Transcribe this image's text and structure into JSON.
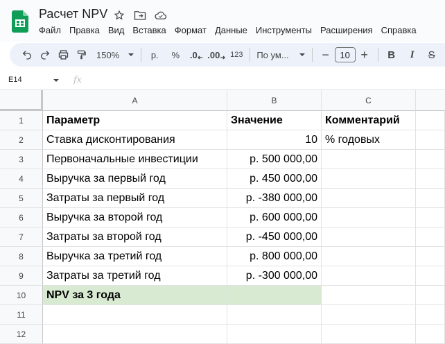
{
  "app": {
    "title": "Расчет NPV",
    "menu": [
      "Файл",
      "Правка",
      "Вид",
      "Вставка",
      "Формат",
      "Данные",
      "Инструменты",
      "Расширения",
      "Справка"
    ]
  },
  "toolbar": {
    "zoom": "150%",
    "currency": "р.",
    "percent": "%",
    "decrease_decimal": ".0",
    "increase_decimal": ".00",
    "number_format": "123",
    "font": "По ум...",
    "font_size": "10",
    "minus": "−",
    "plus": "+",
    "bold": "B",
    "italic": "I",
    "strike": "S"
  },
  "formula_bar": {
    "cell_ref": "E14",
    "fx": "fx"
  },
  "sheet": {
    "columns": [
      "A",
      "B",
      "C"
    ],
    "rows": [
      {
        "num": "1",
        "a": "Параметр",
        "b": "Значение",
        "c": "Комментарий",
        "bold": true
      },
      {
        "num": "2",
        "a": "Ставка дисконтирования",
        "b": "10",
        "c": "% годовых"
      },
      {
        "num": "3",
        "a": "Первоначальные инвестиции",
        "b": "р.  500 000,00",
        "c": ""
      },
      {
        "num": "4",
        "a": "Выручка за первый год",
        "b": "р.  450 000,00",
        "c": ""
      },
      {
        "num": "5",
        "a": "Затраты за первый год",
        "b": "р. -380 000,00",
        "c": ""
      },
      {
        "num": "6",
        "a": "Выручка за второй год",
        "b": "р.  600 000,00",
        "c": ""
      },
      {
        "num": "7",
        "a": "Затраты за второй год",
        "b": "р. -450 000,00",
        "c": ""
      },
      {
        "num": "8",
        "a": "Выручка за третий год",
        "b": "р.  800 000,00",
        "c": ""
      },
      {
        "num": "9",
        "a": "Затраты за третий год",
        "b": "р. -300 000,00",
        "c": ""
      },
      {
        "num": "10",
        "a": "NPV за 3 года",
        "b": "",
        "c": "",
        "bold": true,
        "highlight": "#d9ead3"
      },
      {
        "num": "11",
        "a": "",
        "b": "",
        "c": ""
      },
      {
        "num": "12",
        "a": "",
        "b": "",
        "c": ""
      }
    ]
  }
}
